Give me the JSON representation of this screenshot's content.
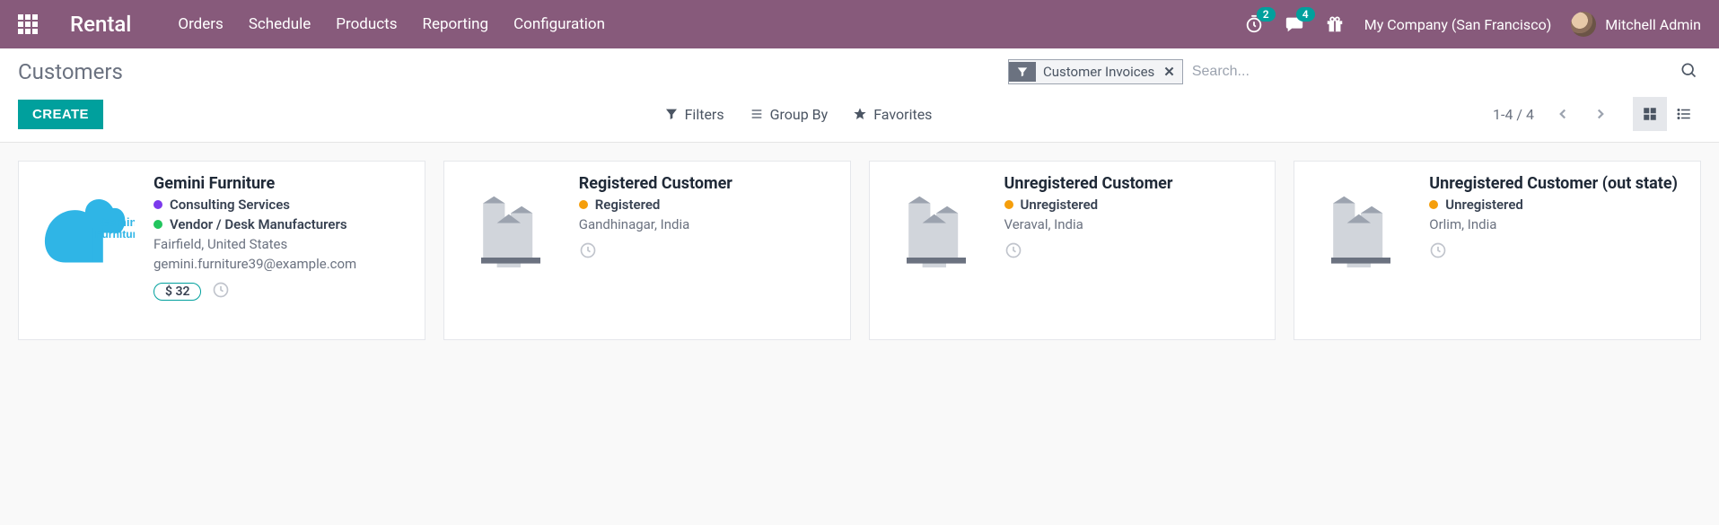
{
  "topbar": {
    "brand": "Rental",
    "nav": [
      "Orders",
      "Schedule",
      "Products",
      "Reporting",
      "Configuration"
    ],
    "clock_badge": "2",
    "chat_badge": "4",
    "company": "My Company (San Francisco)",
    "user": "Mitchell Admin"
  },
  "control": {
    "page_title": "Customers",
    "filter_chip": "Customer Invoices",
    "search_placeholder": "Search...",
    "create_label": "CREATE",
    "filters": "Filters",
    "groupby": "Group By",
    "favorites": "Favorites",
    "pager": "1-4 / 4"
  },
  "cards": [
    {
      "title": "Gemini Furniture",
      "tags": [
        {
          "color": "purple",
          "label": "Consulting Services"
        },
        {
          "color": "green",
          "label": "Vendor / Desk Manufacturers"
        }
      ],
      "location": "Fairfield, United States",
      "email": "gemini.furniture39@example.com",
      "pill": "$ 32",
      "has_clock": true,
      "logo": "gemini"
    },
    {
      "title": "Registered Customer",
      "tags": [
        {
          "color": "orange",
          "label": "Registered"
        }
      ],
      "location": "Gandhinagar, India",
      "has_clock": true,
      "logo": "default"
    },
    {
      "title": "Unregistered Customer",
      "tags": [
        {
          "color": "orange",
          "label": "Unregistered"
        }
      ],
      "location": "Veraval, India",
      "has_clock": true,
      "logo": "default"
    },
    {
      "title": "Unregistered Customer (out state)",
      "tags": [
        {
          "color": "orange",
          "label": "Unregistered"
        }
      ],
      "location": "Orlim, India",
      "has_clock": true,
      "logo": "default"
    }
  ]
}
